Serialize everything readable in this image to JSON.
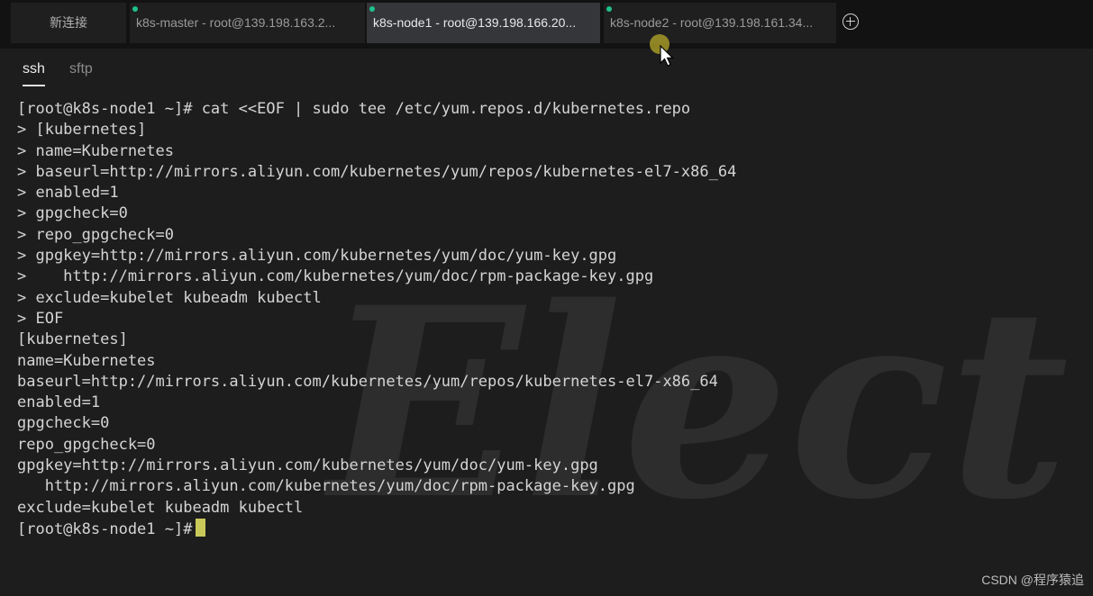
{
  "tabs": [
    {
      "label": "新连接",
      "active": false,
      "status_dot": false
    },
    {
      "label": "k8s-master - root@139.198.163.2...",
      "active": false,
      "status_dot": true
    },
    {
      "label": "k8s-node1 - root@139.198.166.20...",
      "active": true,
      "status_dot": true
    },
    {
      "label": "k8s-node2 - root@139.198.161.34...",
      "active": false,
      "status_dot": true
    }
  ],
  "subtabs": [
    {
      "label": "ssh",
      "active": true
    },
    {
      "label": "sftp",
      "active": false
    }
  ],
  "terminal": {
    "lines": [
      "[root@k8s-node1 ~]# cat <<EOF | sudo tee /etc/yum.repos.d/kubernetes.repo",
      "> [kubernetes]",
      "> name=Kubernetes",
      "> baseurl=http://mirrors.aliyun.com/kubernetes/yum/repos/kubernetes-el7-x86_64",
      "> enabled=1",
      "> gpgcheck=0",
      "> repo_gpgcheck=0",
      "> gpgkey=http://mirrors.aliyun.com/kubernetes/yum/doc/yum-key.gpg",
      ">    http://mirrors.aliyun.com/kubernetes/yum/doc/rpm-package-key.gpg",
      "> exclude=kubelet kubeadm kubectl",
      "> EOF",
      "[kubernetes]",
      "name=Kubernetes",
      "baseurl=http://mirrors.aliyun.com/kubernetes/yum/repos/kubernetes-el7-x86_64",
      "enabled=1",
      "gpgcheck=0",
      "repo_gpgcheck=0",
      "gpgkey=http://mirrors.aliyun.com/kubernetes/yum/doc/yum-key.gpg",
      "   http://mirrors.aliyun.com/kubernetes/yum/doc/rpm-package-key.gpg",
      "exclude=kubelet kubeadm kubectl"
    ],
    "prompt": "[root@k8s-node1 ~]#"
  },
  "watermark_brand": "Electerm",
  "csdn_watermark": "CSDN @程序猿追",
  "colors": {
    "background": "#1d1d1d",
    "tabbar": "#121212",
    "active_tab": "#34363a",
    "status_dot": "#1ec28b",
    "cursor": "#c9c95a",
    "text": "#d4d4d4"
  },
  "icons": {
    "new_tab": "plus-circle-icon",
    "pointer": "mouse-pointer-icon"
  }
}
